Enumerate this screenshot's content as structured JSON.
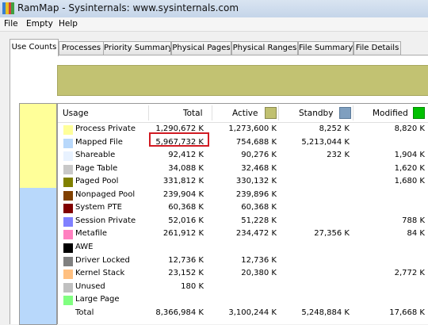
{
  "window": {
    "title": "RamMap - Sysinternals: www.sysinternals.com",
    "icon": "rammap-icon"
  },
  "menu": [
    "File",
    "Empty",
    "Help"
  ],
  "tabs": [
    {
      "label": "Use Counts",
      "active": true
    },
    {
      "label": "Processes",
      "active": false
    },
    {
      "label": "Priority Summary",
      "active": false
    },
    {
      "label": "Physical Pages",
      "active": false
    },
    {
      "label": "Physical Ranges",
      "active": false
    },
    {
      "label": "File Summary",
      "active": false
    },
    {
      "label": "File Details",
      "active": false
    }
  ],
  "colors": {
    "active_bar": "#c2c272",
    "active_legend": "#c0c070",
    "standby_legend": "#7f9fbf",
    "modified_legend": "#00c000",
    "highlight_border": "#d11b23"
  },
  "table": {
    "headers": {
      "usage": "Usage",
      "total": "Total",
      "active": "Active",
      "standby": "Standby",
      "modified": "Modified"
    },
    "rows": [
      {
        "usage": "Process Private",
        "total": "1,290,672 K",
        "active": "1,273,600 K",
        "standby": "8,252 K",
        "modified": "8,820 K",
        "color": "#ffff99"
      },
      {
        "usage": "Mapped File",
        "total": "5,967,732 K",
        "active": "754,688 K",
        "standby": "5,213,044 K",
        "modified": "",
        "color": "#b8d8fb",
        "highlighted": true
      },
      {
        "usage": "Shareable",
        "total": "92,412 K",
        "active": "90,276 K",
        "standby": "232 K",
        "modified": "1,904 K",
        "color": "#e8f2ff"
      },
      {
        "usage": "Page Table",
        "total": "34,088 K",
        "active": "32,468 K",
        "standby": "",
        "modified": "1,620 K",
        "color": "#c8c8c8"
      },
      {
        "usage": "Paged Pool",
        "total": "331,812 K",
        "active": "330,132 K",
        "standby": "",
        "modified": "1,680 K",
        "color": "#808000"
      },
      {
        "usage": "Nonpaged Pool",
        "total": "239,904 K",
        "active": "239,896 K",
        "standby": "",
        "modified": "",
        "color": "#804000"
      },
      {
        "usage": "System PTE",
        "total": "60,368 K",
        "active": "60,368 K",
        "standby": "",
        "modified": "",
        "color": "#800000"
      },
      {
        "usage": "Session Private",
        "total": "52,016 K",
        "active": "51,228 K",
        "standby": "",
        "modified": "788 K",
        "color": "#8080ff"
      },
      {
        "usage": "Metafile",
        "total": "261,912 K",
        "active": "234,472 K",
        "standby": "27,356 K",
        "modified": "84 K",
        "color": "#ff80c0"
      },
      {
        "usage": "AWE",
        "total": "",
        "active": "",
        "standby": "",
        "modified": "",
        "color": "#000000"
      },
      {
        "usage": "Driver Locked",
        "total": "12,736 K",
        "active": "12,736 K",
        "standby": "",
        "modified": "",
        "color": "#808080"
      },
      {
        "usage": "Kernel Stack",
        "total": "23,152 K",
        "active": "20,380 K",
        "standby": "",
        "modified": "2,772 K",
        "color": "#ffc080"
      },
      {
        "usage": "Unused",
        "total": "180 K",
        "active": "",
        "standby": "",
        "modified": "",
        "color": "#c0c0c0"
      },
      {
        "usage": "Large Page",
        "total": "",
        "active": "",
        "standby": "",
        "modified": "",
        "color": "#80ff80"
      },
      {
        "usage": "Total",
        "total": "8,366,984 K",
        "active": "3,100,244 K",
        "standby": "5,248,884 K",
        "modified": "17,668 K",
        "color": ""
      }
    ]
  }
}
